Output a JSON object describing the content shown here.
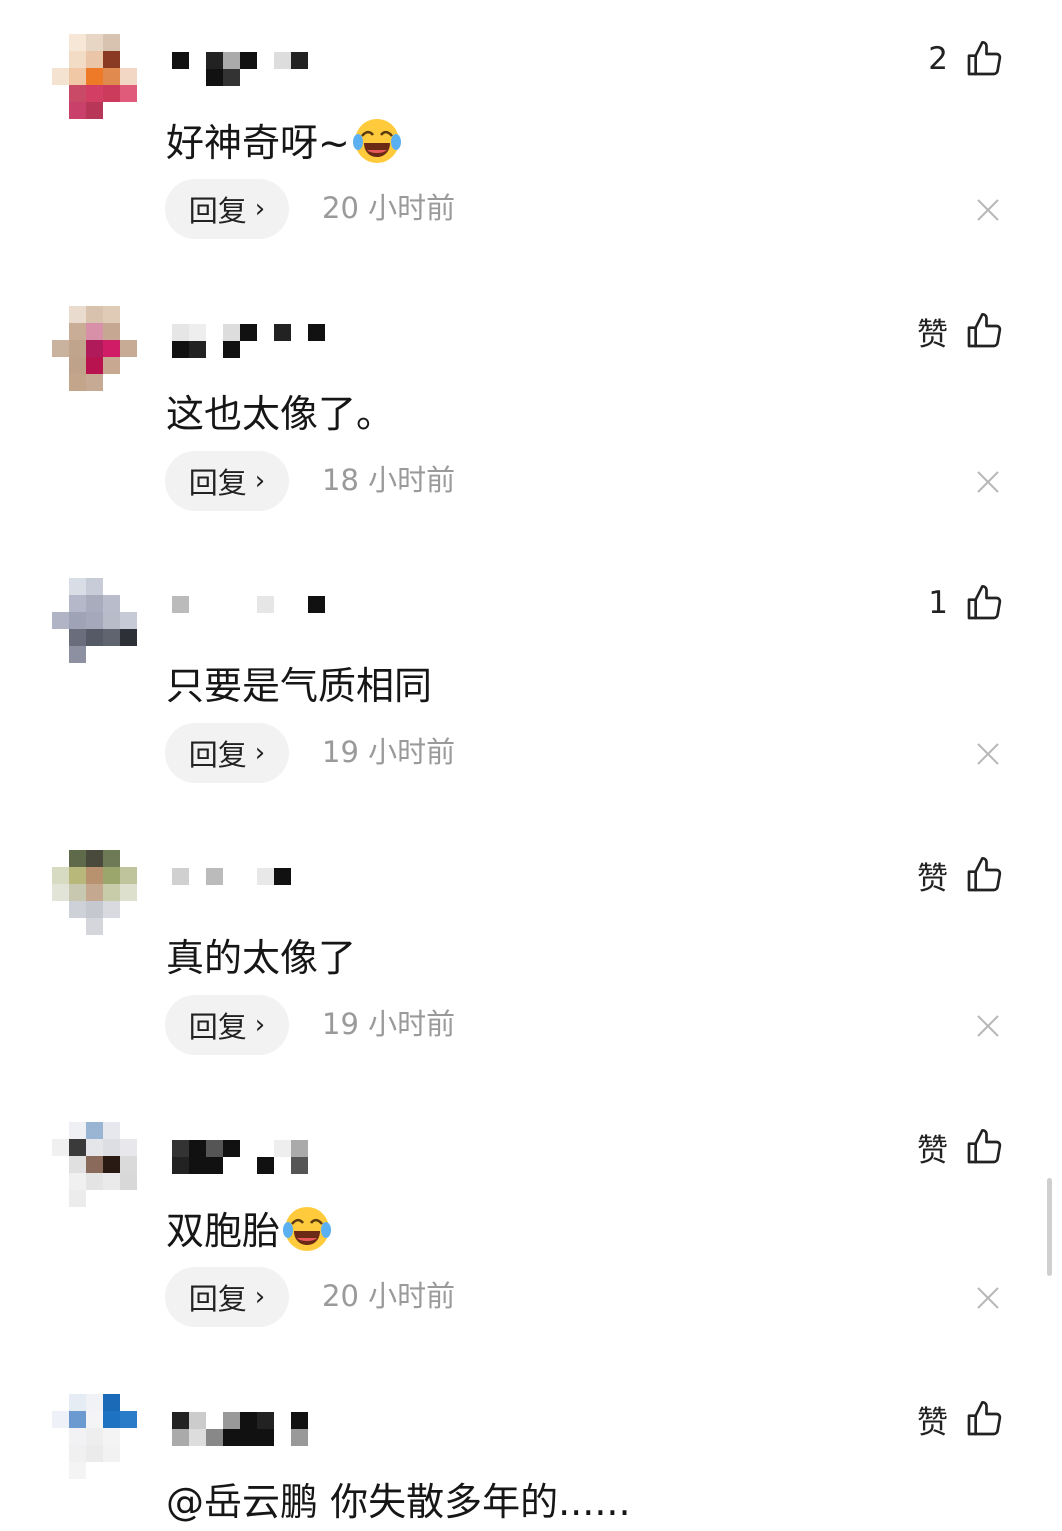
{
  "colors": {
    "text": "#161616",
    "time": "#9a9a9a",
    "reply_bg": "#f2f2f2",
    "icon": "#222222"
  },
  "reply_label": "回复",
  "comments": [
    {
      "text": "好神奇呀~",
      "emoji": "crying-laughing-emoji",
      "time": "20 小时前",
      "likes": "2"
    },
    {
      "text": "这也太像了。",
      "time": "18 小时前",
      "likes": "赞"
    },
    {
      "text": "只要是气质相同",
      "time": "19 小时前",
      "likes": "1"
    },
    {
      "text": "真的太像了",
      "time": "19 小时前",
      "likes": "赞"
    },
    {
      "text": "双胞胎",
      "emoji": "crying-laughing-emoji",
      "time": "20 小时前",
      "likes": "赞"
    },
    {
      "text": "@岳云鹏 你失散多年的......",
      "likes": "赞"
    }
  ]
}
